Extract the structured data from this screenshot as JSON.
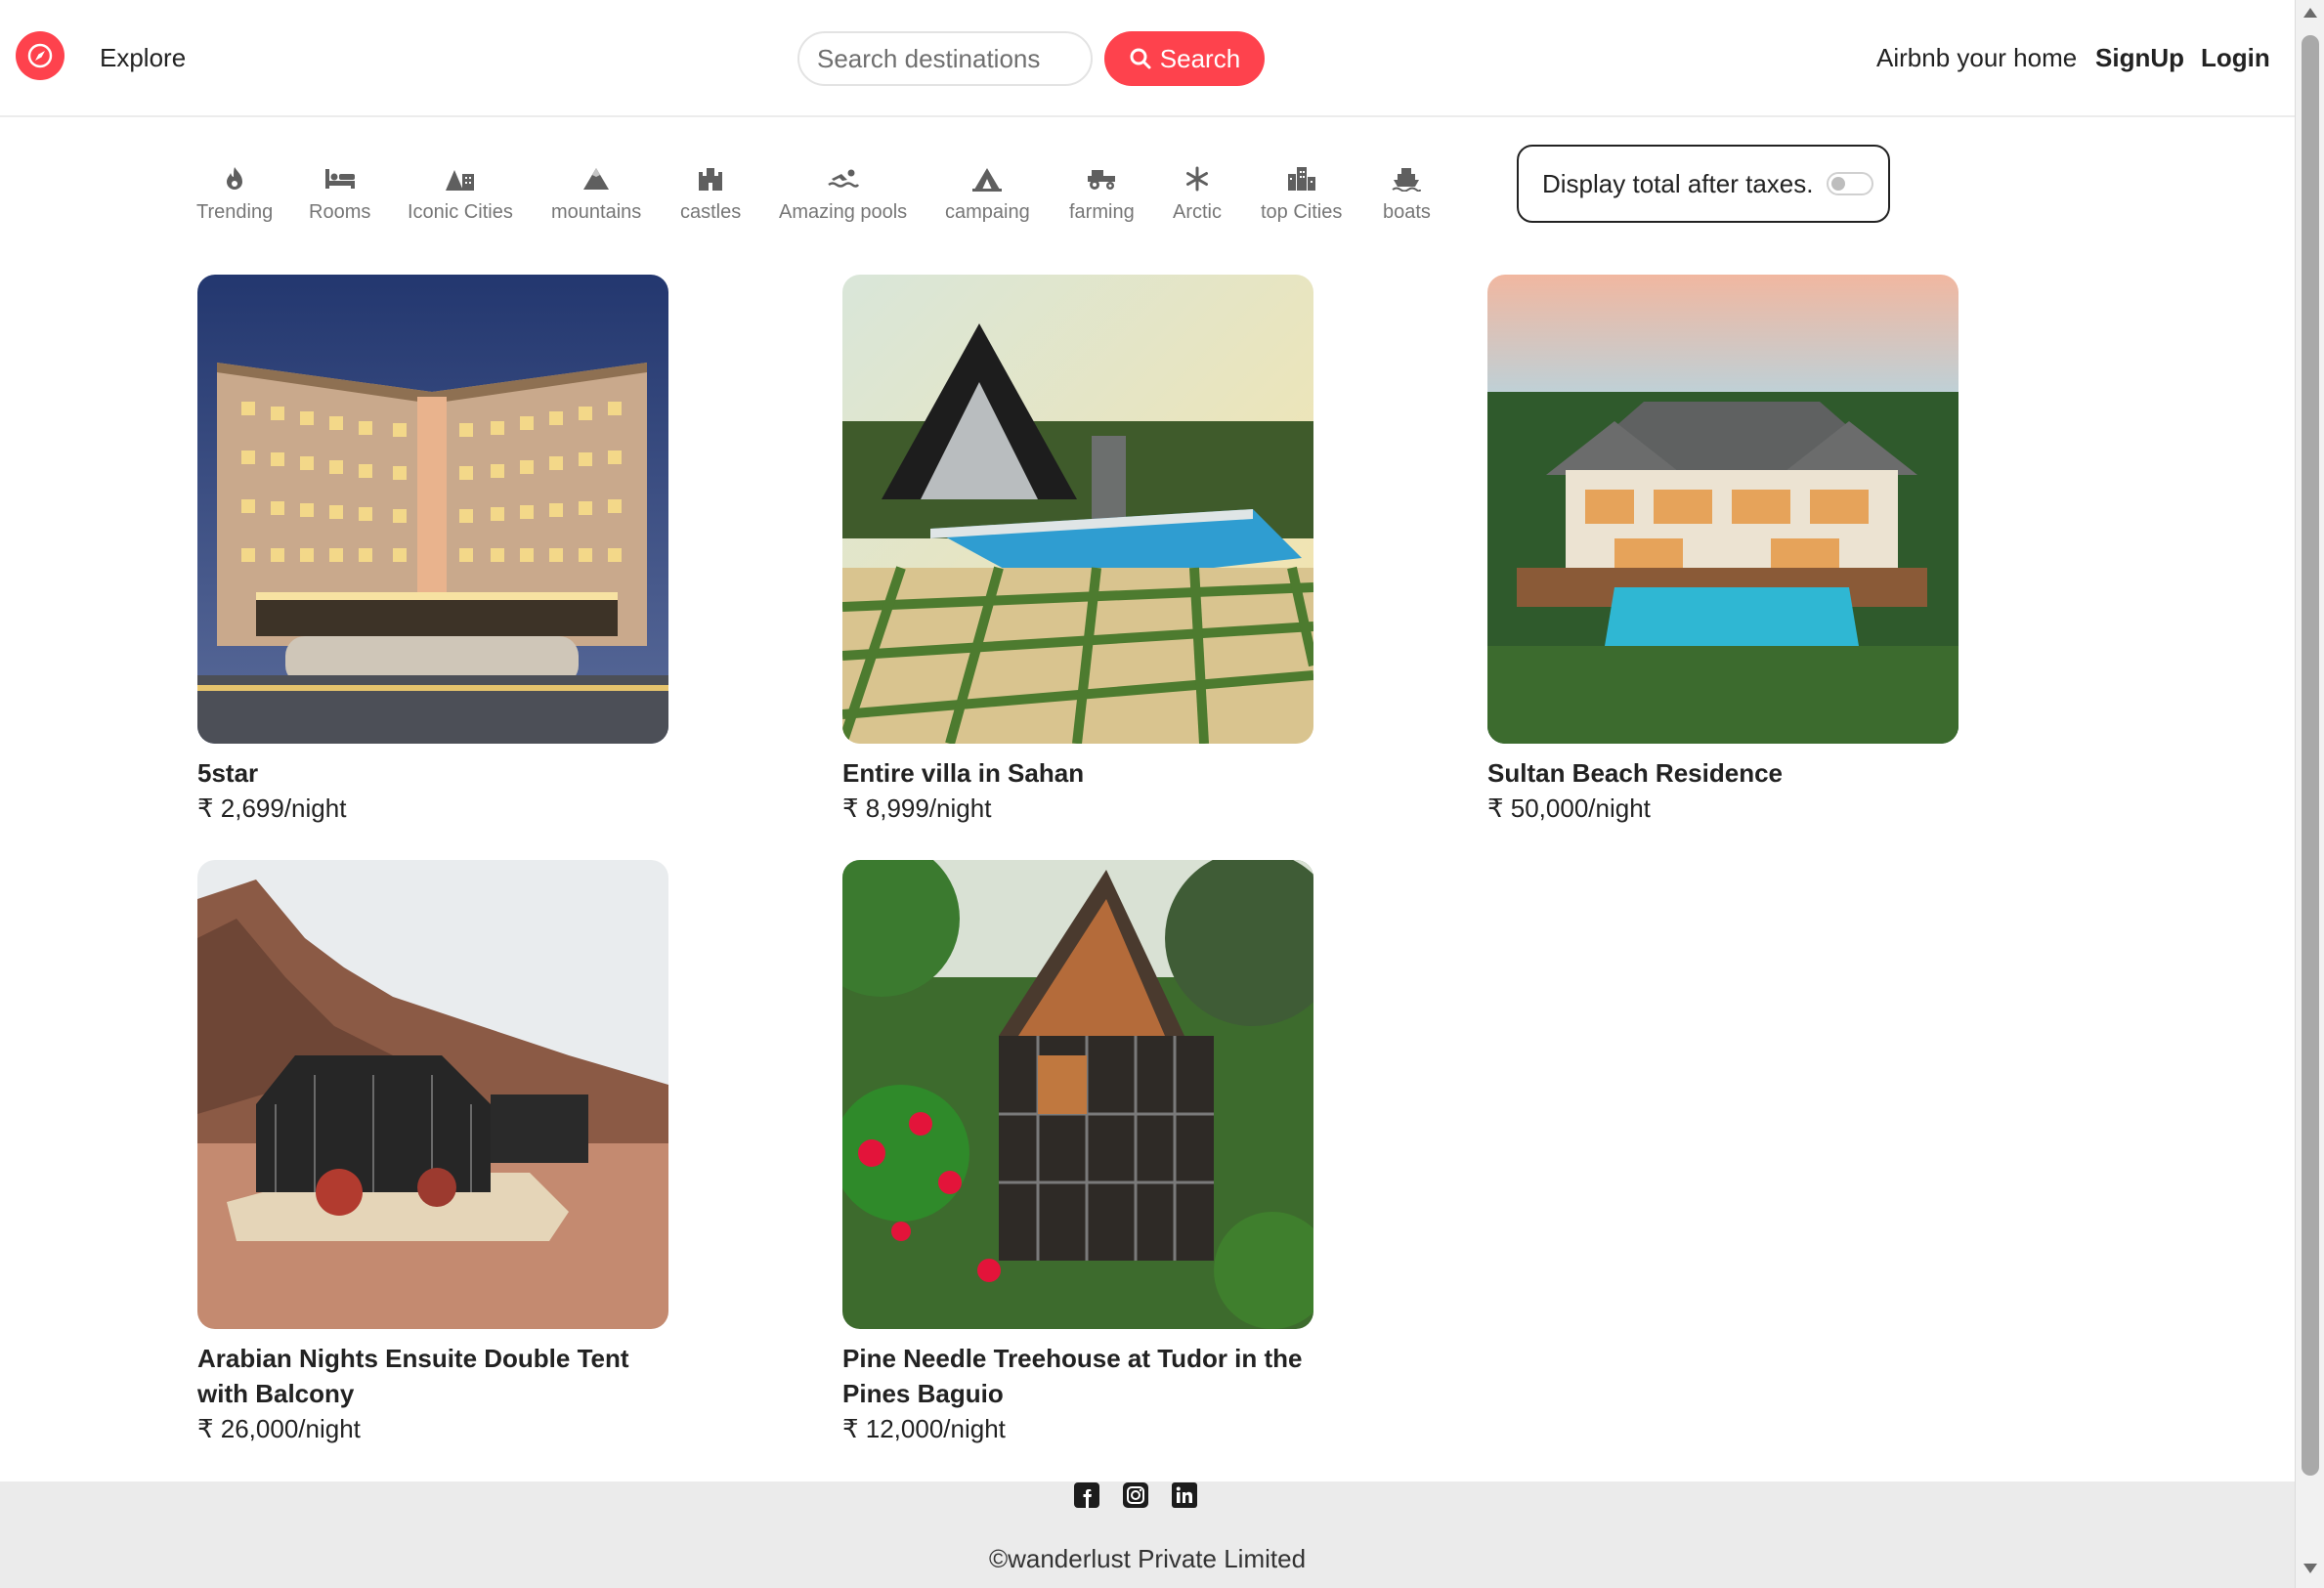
{
  "navbar": {
    "logo_icon": "compass-icon",
    "explore_label": "Explore",
    "search_placeholder": "Search destinations",
    "search_button_label": "Search",
    "host_label": "Airbnb your home",
    "signup_label": "SignUp",
    "login_label": "Login",
    "brand_color": "#fe424d"
  },
  "filters": [
    {
      "label": "Trending",
      "icon": "fire-icon"
    },
    {
      "label": "Rooms",
      "icon": "bed-icon"
    },
    {
      "label": "Iconic Cities",
      "icon": "mountain-city-icon"
    },
    {
      "label": "mountains",
      "icon": "mountain-icon"
    },
    {
      "label": "castles",
      "icon": "castle-icon"
    },
    {
      "label": "Amazing pools",
      "icon": "person-swimming-icon"
    },
    {
      "label": "campaing",
      "icon": "campground-icon"
    },
    {
      "label": "farming",
      "icon": "tractor-icon"
    },
    {
      "label": "Arctic",
      "icon": "snowflake-icon"
    },
    {
      "label": "top Cities",
      "icon": "city-icon"
    },
    {
      "label": "boats",
      "icon": "ship-icon"
    }
  ],
  "tax_toggle": {
    "label": "Display total after taxes.",
    "enabled": false
  },
  "listings": [
    {
      "title": "5star",
      "price": "₹ 2,699/night",
      "image": "hotel-tower-night-photo"
    },
    {
      "title": "Entire villa in Sahan",
      "price": "₹ 8,999/night",
      "image": "a-frame-villa-pool-photo"
    },
    {
      "title": "Sultan Beach Residence",
      "price": "₹ 50,000/night",
      "image": "beach-villa-pool-photo"
    },
    {
      "title": "Arabian Nights Ensuite Double Tent with Balcony",
      "price": "₹ 26,000/night",
      "image": "desert-tent-photo"
    },
    {
      "title": "Pine Needle Treehouse at Tudor in the Pines Baguio",
      "price": "₹ 12,000/night",
      "image": "glass-treehouse-photo"
    }
  ],
  "footer": {
    "socials": [
      "facebook-icon",
      "instagram-icon",
      "linkedin-icon"
    ],
    "copyright": "©wanderlust Private Limited"
  }
}
